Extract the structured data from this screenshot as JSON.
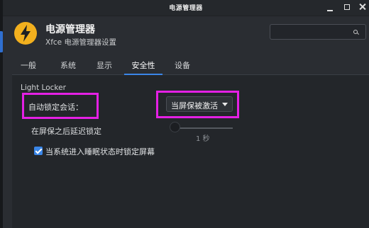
{
  "window": {
    "title": "电源管理器"
  },
  "header": {
    "app_name": "电源管理器",
    "subtitle": "Xfce 电源管理器设置",
    "search_placeholder": ""
  },
  "tabs": [
    {
      "label": "一般"
    },
    {
      "label": "系统"
    },
    {
      "label": "显示"
    },
    {
      "label": "安全性",
      "active": true
    },
    {
      "label": "设备"
    }
  ],
  "security": {
    "section_title": "Light Locker",
    "lock_session_label": "自动锁定会话：",
    "lock_session_value": "当屏保被激活",
    "delay_label": "在屏保之后延迟锁定",
    "delay_value": 1,
    "delay_value_text": "1 秒",
    "sleep_lock_label": "当系统进入睡眠状态时锁定屏幕",
    "sleep_lock_checked": true
  },
  "colors": {
    "accent": "#3a86e8",
    "highlight": "#e420e4",
    "app_icon_bg": "#f2b01e"
  },
  "icons": {
    "app": "lightning-bolt-icon",
    "search": "search-icon",
    "dropdown": "caret-down-icon"
  }
}
